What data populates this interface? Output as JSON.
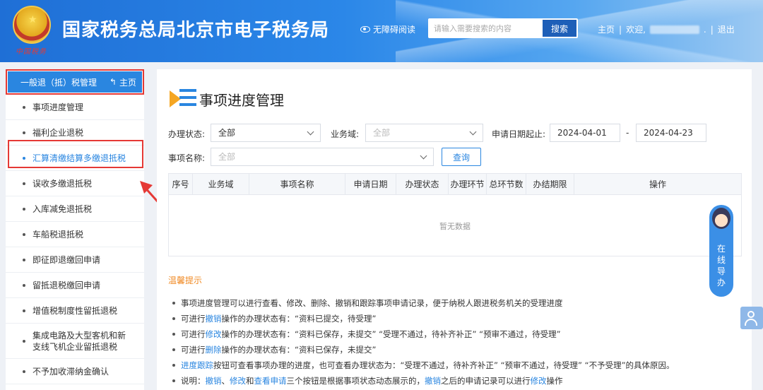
{
  "header": {
    "site_title": "国家税务总局北京市电子税务局",
    "emblem_text": "中国税务",
    "accessibility": "无障碍阅读",
    "search_placeholder": "请输入需要搜索的内容",
    "search_button": "搜索",
    "home": "主页",
    "sep1": "|",
    "welcome": "欢迎,",
    "dot": ".",
    "sep2": "|",
    "logout": "退出"
  },
  "sidebar": {
    "section_title": "一般退（抵）税管理",
    "home_link": "主页",
    "items": [
      {
        "label": "事项进度管理"
      },
      {
        "label": "福利企业退税"
      },
      {
        "label": "汇算清缴结算多缴退抵税"
      },
      {
        "label": "误收多缴退抵税"
      },
      {
        "label": "入库减免退抵税"
      },
      {
        "label": "车船税退抵税"
      },
      {
        "label": "即征即退缴回申请"
      },
      {
        "label": "留抵退税缴回申请"
      },
      {
        "label": "增值税制度性留抵退税"
      },
      {
        "label": "集成电路及大型客机和新支线飞机企业留抵退税"
      },
      {
        "label": "不予加收滞纳金确认"
      }
    ]
  },
  "main": {
    "title": "事项进度管理",
    "filters": {
      "status_label": "办理状态:",
      "status_value": "全部",
      "domain_label": "业务域:",
      "domain_value": "全部",
      "date_label": "申请日期起止:",
      "date_start": "2024-04-01",
      "date_sep": "-",
      "date_end": "2024-04-23",
      "item_label": "事项名称:",
      "item_value": "全部",
      "query_button": "查询"
    },
    "table": {
      "columns": [
        "序号",
        "业务域",
        "事项名称",
        "申请日期",
        "办理状态",
        "办理环节",
        "总环节数",
        "办结期限",
        "操作"
      ],
      "empty_text": "暂无数据"
    },
    "tips_title": "温馨提示",
    "tips": {
      "t1": "事项进度管理可以进行查看、修改、删除、撤销和跟踪事项申请记录，便于纳税人跟进税务机关的受理进度",
      "t2a": "可进行",
      "t2link": "撤销",
      "t2b": "操作的办理状态有：“资料已提交，待受理”",
      "t3a": "可进行",
      "t3link": "修改",
      "t3b": "操作的办理状态有：“资料已保存，未提交” “受理不通过，待补齐补正” “预审不通过，待受理”",
      "t4a": "可进行",
      "t4link": "删除",
      "t4b": "操作的办理状态有：“资料已保存，未提交”",
      "t5link": "进度跟踪",
      "t5b": "按钮可查看事项办理的进度，也可查看办理状态为：“受理不通过，待补齐补正” “预审不通过，待受理” “不予受理”的具体原因。",
      "t6a": "说明：",
      "t6l1": "撤销",
      "t6s1": "、",
      "t6l2": "修改",
      "t6s2": "和",
      "t6l3": "查看申请",
      "t6b": "三个按钮是根据事项状态动态展示的，",
      "t6l4": "撤销",
      "t6c": "之后的申请记录可以进行",
      "t6l5": "修改",
      "t6d": "操作"
    }
  },
  "guide": {
    "text": "在线导办"
  },
  "colors": {
    "header_blue": "#2b87e8",
    "accent": "#2a86e0",
    "highlight_red": "#e53935",
    "tips_orange": "#f08a24"
  }
}
